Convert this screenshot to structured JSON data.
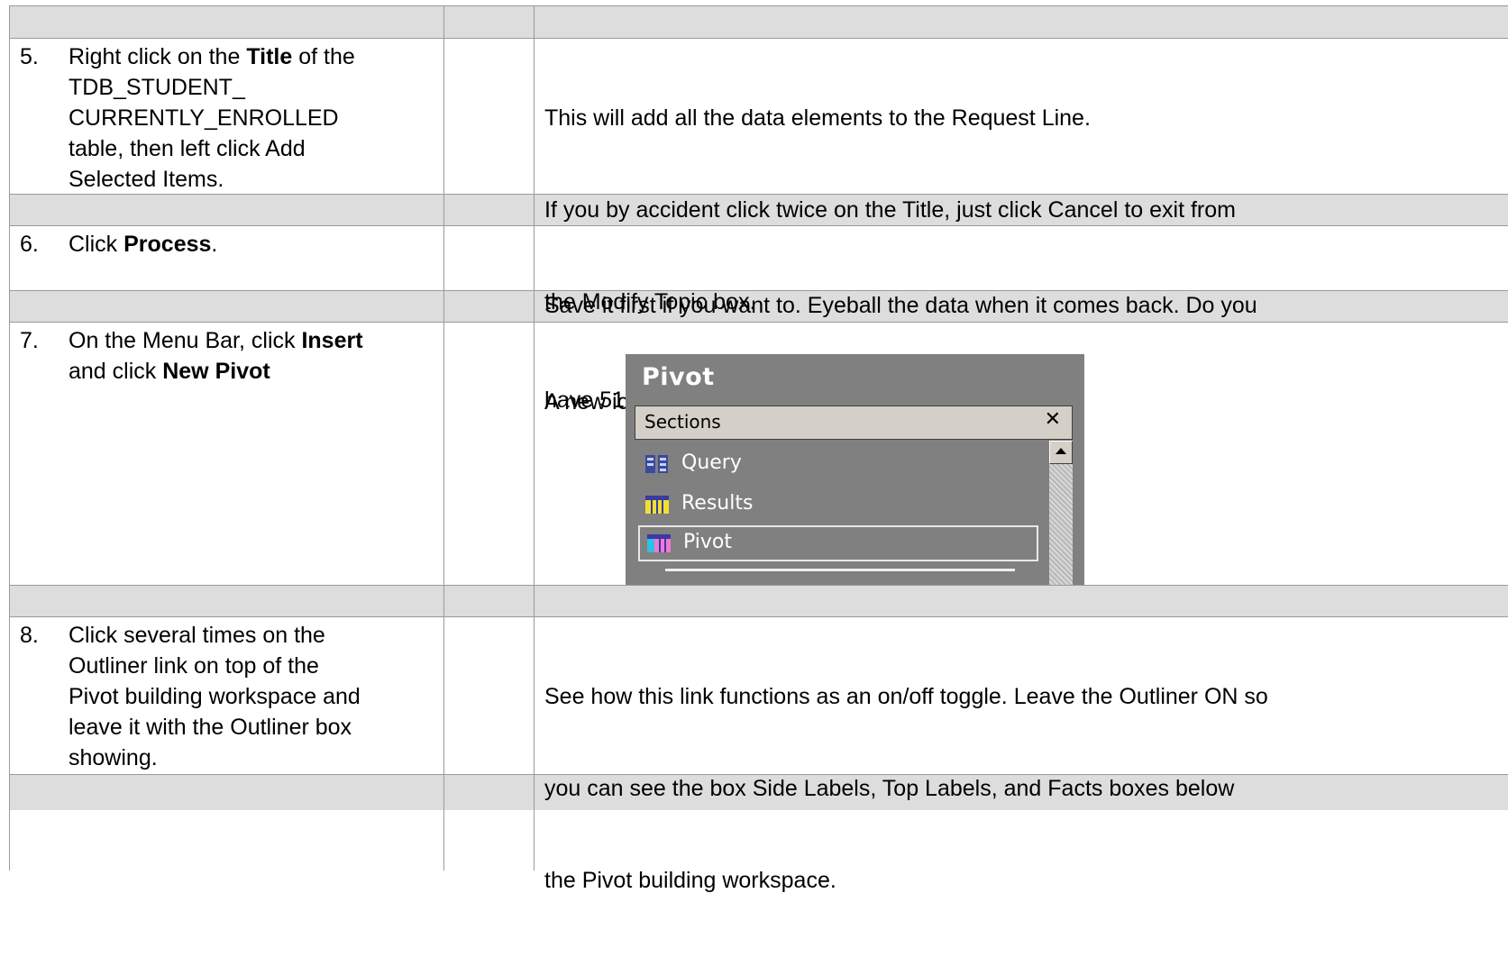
{
  "rows": [
    {
      "number": "5.",
      "instruction": [
        "Right click on the ",
        {
          "b": "Title"
        },
        " of the\nTDB_STUDENT_\nCURRENTLY_ENROLLED\ntable, then left click Add\nSelected Items."
      ],
      "note_lines": [
        "This will add all the data elements to the Request Line.",
        "If you by accident click twice on the Title, just click Cancel to exit from",
        "the Modify Topic box."
      ]
    },
    {
      "number": "6.",
      "instruction": [
        "Click ",
        {
          "b": "Process"
        },
        "."
      ],
      "note_lines": [
        "Save it first if you want to. Eyeball the data when it comes back. Do you",
        "have 513 records?"
      ]
    },
    {
      "number": "7.",
      "instruction": [
        "On the Menu Bar, click ",
        {
          "b": "Insert"
        },
        "\nand click ",
        {
          "b": "New Pivot"
        }
      ],
      "note_lines": [
        "A new icon will appear in the Sections frame."
      ]
    },
    {
      "number": "8.",
      "instruction": [
        "Click several times on the\nOutliner link on top of the\nPivot building workspace and\nleave it with the Outliner box\nshowing."
      ],
      "note_lines": [
        "See how this link functions as an on/off toggle. Leave the Outliner ON so",
        "you can see the box Side Labels, Top Labels, and Facts boxes below",
        "the Pivot building workspace."
      ]
    }
  ],
  "pivot_screenshot": {
    "title": "Pivot",
    "header_label": "Sections",
    "close_glyph": "✕",
    "items": [
      {
        "label": "Query",
        "icon": "query-icon",
        "selected": false
      },
      {
        "label": "Results",
        "icon": "results-icon",
        "selected": false
      },
      {
        "label": "Pivot",
        "icon": "pivot-icon",
        "selected": true
      }
    ]
  }
}
